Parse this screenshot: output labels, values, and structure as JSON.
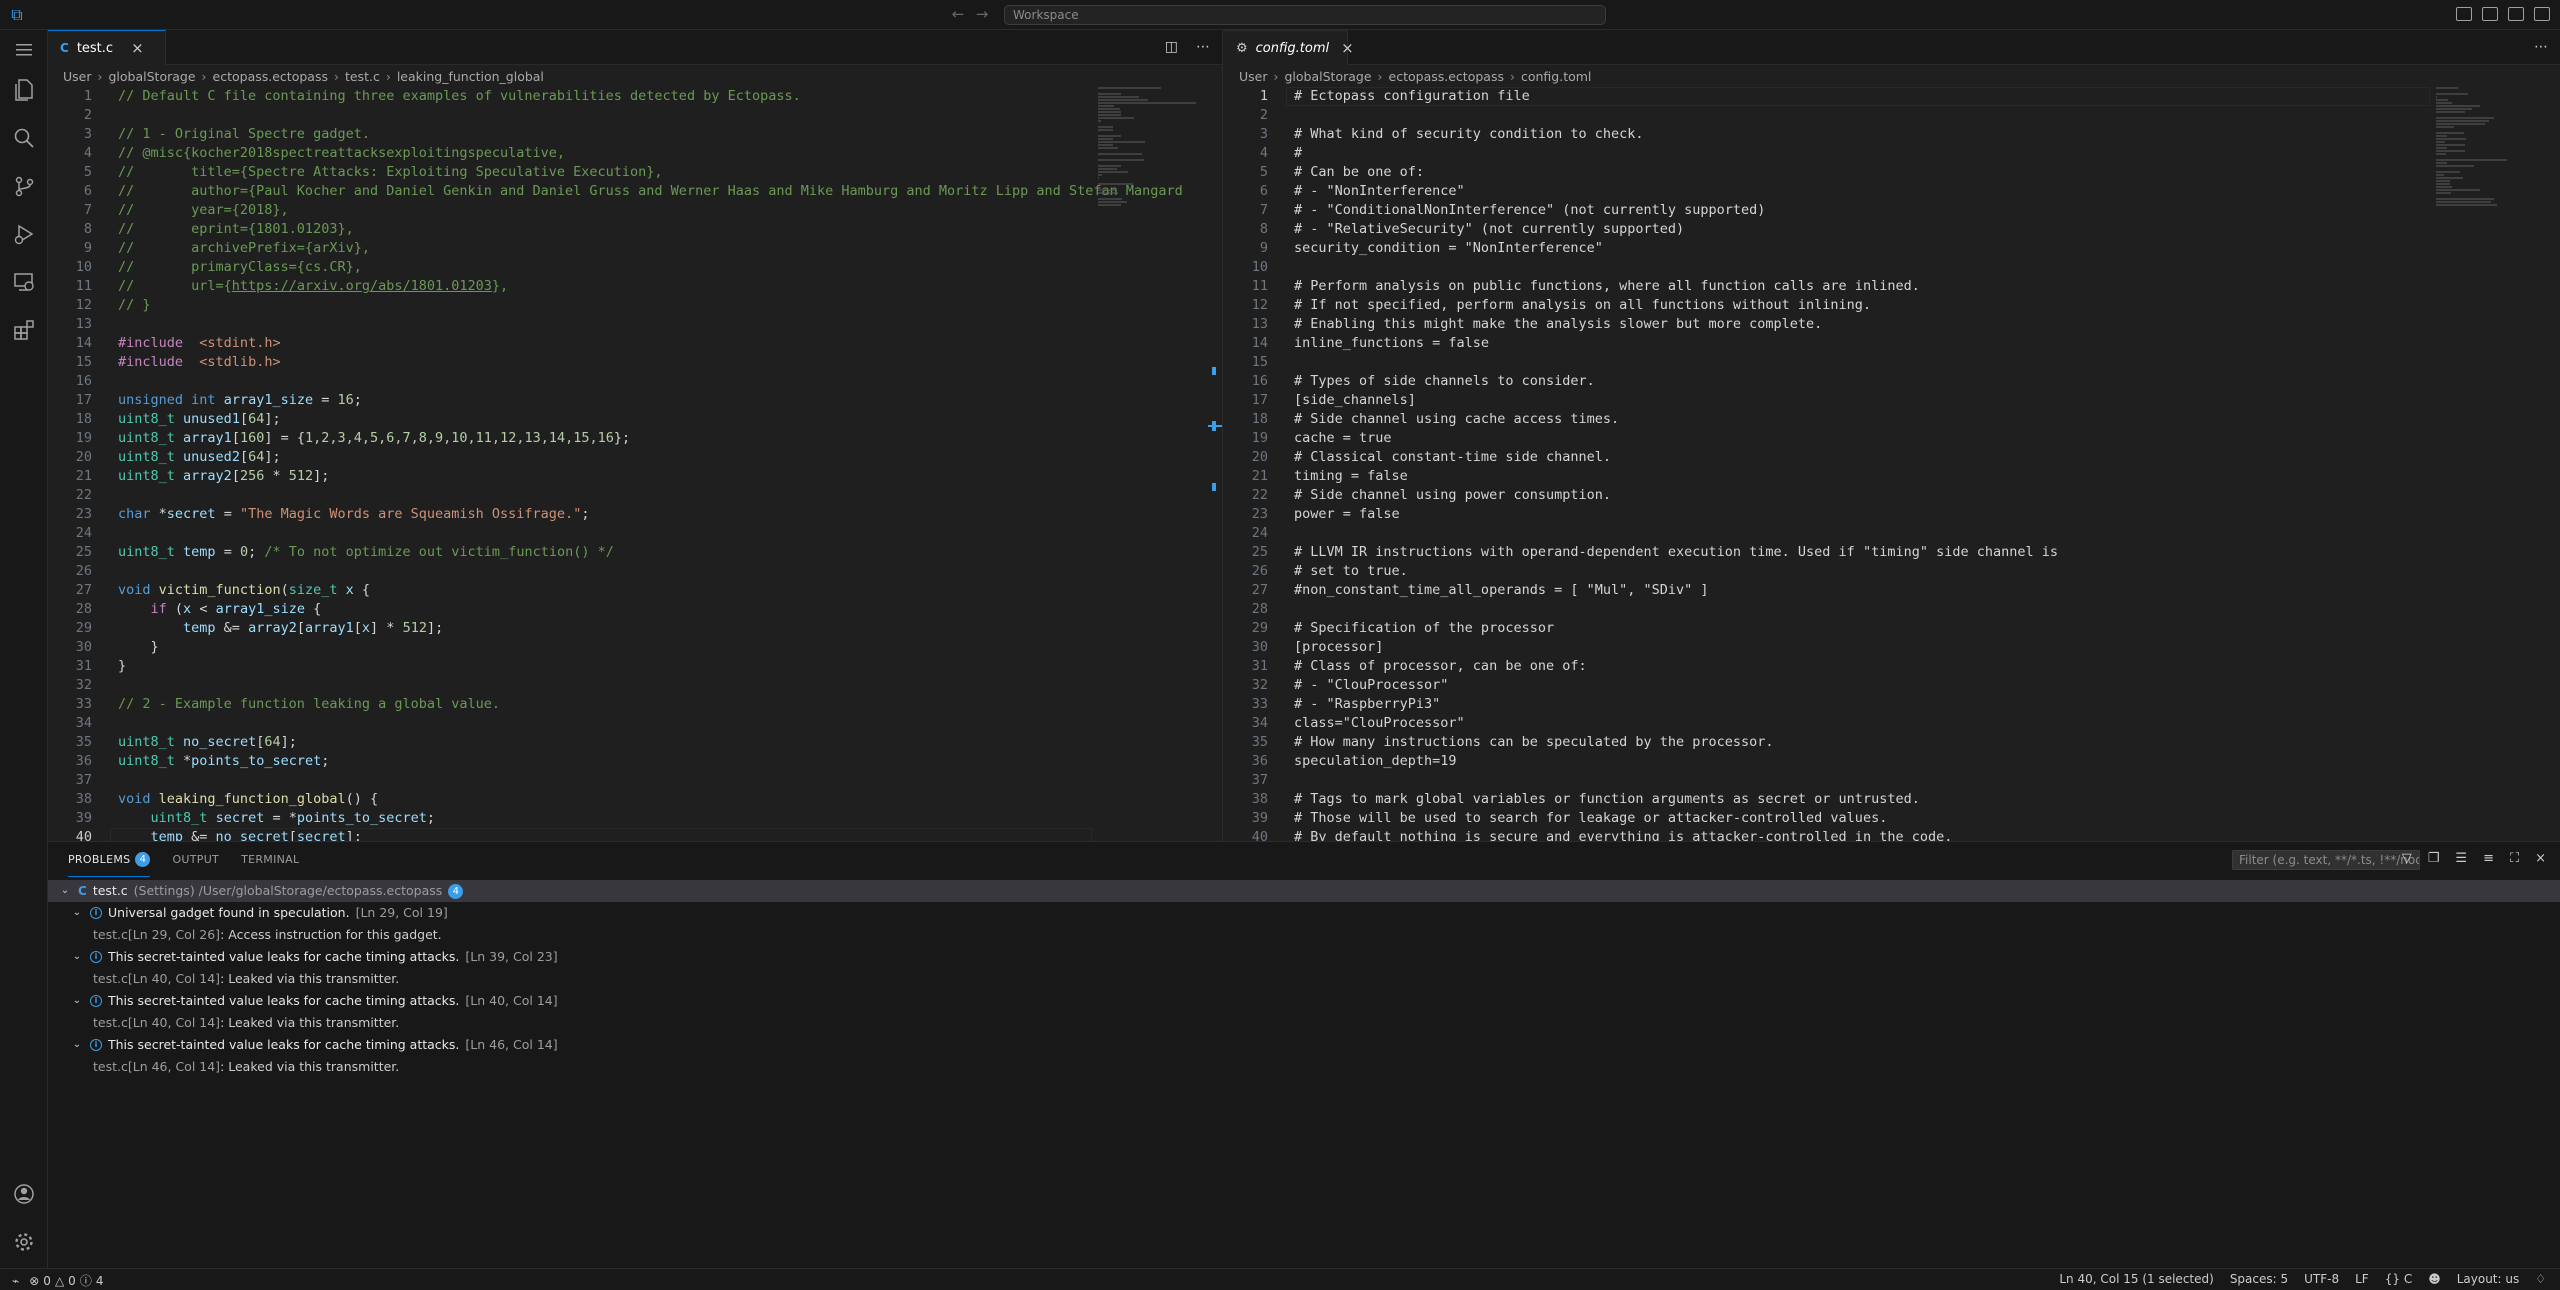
{
  "titlebar": {
    "search_placeholder": "Workspace",
    "colors": {
      "accent": "#0078d4",
      "info": "#3c9ee9"
    }
  },
  "left_editor": {
    "tab": {
      "icon": "C",
      "label": "test.c"
    },
    "breadcrumb": [
      "User",
      "globalStorage",
      "ectopass.ectopass",
      "test.c",
      "leaking_function_global"
    ],
    "active_line": 40,
    "lines": [
      [
        [
          "c-com",
          "// Default C file containing three examples of vulnerabilities detected by Ectopass."
        ]
      ],
      [],
      [
        [
          "c-com",
          "// 1 - Original Spectre gadget."
        ]
      ],
      [
        [
          "c-com",
          "// @misc{kocher2018spectreattacksexploitingspeculative,"
        ]
      ],
      [
        [
          "c-com",
          "//       title={Spectre Attacks: Exploiting Speculative Execution},"
        ]
      ],
      [
        [
          "c-com",
          "//       author={Paul Kocher and Daniel Genkin and Daniel Gruss and Werner Haas and Mike Hamburg and Moritz Lipp and Stefan Mangard"
        ]
      ],
      [
        [
          "c-com",
          "//       year={2018},"
        ]
      ],
      [
        [
          "c-com",
          "//       eprint={1801.01203},"
        ]
      ],
      [
        [
          "c-com",
          "//       archivePrefix={arXiv},"
        ]
      ],
      [
        [
          "c-com",
          "//       primaryClass={cs.CR},"
        ]
      ],
      [
        [
          "c-com",
          "//       url={"
        ],
        [
          "c-link",
          "https://arxiv.org/abs/1801.01203"
        ],
        [
          "c-com",
          "},"
        ]
      ],
      [
        [
          "c-com",
          "// }"
        ]
      ],
      [],
      [
        [
          "c-pp",
          "#include"
        ],
        [
          "",
          "  "
        ],
        [
          "c-inc",
          "<stdint.h>"
        ]
      ],
      [
        [
          "c-pp",
          "#include"
        ],
        [
          "",
          "  "
        ],
        [
          "c-inc",
          "<stdlib.h>"
        ]
      ],
      [],
      [
        [
          "c-kw",
          "unsigned int"
        ],
        [
          "",
          " "
        ],
        [
          "c-var",
          "array1_size"
        ],
        [
          "",
          " = "
        ],
        [
          "c-num",
          "16"
        ],
        [
          "",
          ";"
        ]
      ],
      [
        [
          "c-type",
          "uint8_t"
        ],
        [
          "",
          " "
        ],
        [
          "c-var",
          "unused1"
        ],
        [
          "",
          "["
        ],
        [
          "c-num",
          "64"
        ],
        [
          "",
          "];"
        ]
      ],
      [
        [
          "c-type",
          "uint8_t"
        ],
        [
          "",
          " "
        ],
        [
          "c-var",
          "array1"
        ],
        [
          "",
          "["
        ],
        [
          "c-num",
          "160"
        ],
        [
          "",
          "] = {"
        ],
        [
          "c-num",
          "1,2,3,4,5,6,7,8,9,10,11,12,13,14,15,16"
        ],
        [
          "",
          "};"
        ]
      ],
      [
        [
          "c-type",
          "uint8_t"
        ],
        [
          "",
          " "
        ],
        [
          "c-var",
          "unused2"
        ],
        [
          "",
          "["
        ],
        [
          "c-num",
          "64"
        ],
        [
          "",
          "];"
        ]
      ],
      [
        [
          "c-type",
          "uint8_t"
        ],
        [
          "",
          " "
        ],
        [
          "c-var",
          "array2"
        ],
        [
          "",
          "["
        ],
        [
          "c-num",
          "256"
        ],
        [
          "",
          " * "
        ],
        [
          "c-num",
          "512"
        ],
        [
          "",
          "];"
        ]
      ],
      [],
      [
        [
          "c-kw",
          "char"
        ],
        [
          "",
          " *"
        ],
        [
          "c-var",
          "secret"
        ],
        [
          "",
          " = "
        ],
        [
          "c-str",
          "\"The Magic Words are Squeamish Ossifrage.\""
        ],
        [
          "",
          ";"
        ]
      ],
      [],
      [
        [
          "c-type",
          "uint8_t"
        ],
        [
          "",
          " "
        ],
        [
          "c-var",
          "temp"
        ],
        [
          "",
          " = "
        ],
        [
          "c-num",
          "0"
        ],
        [
          "",
          "; "
        ],
        [
          "c-com",
          "/* To not optimize out victim_function() */"
        ]
      ],
      [],
      [
        [
          "c-kw",
          "void"
        ],
        [
          "",
          " "
        ],
        [
          "c-fn",
          "victim_function"
        ],
        [
          "",
          "("
        ],
        [
          "c-type",
          "size_t"
        ],
        [
          "",
          " "
        ],
        [
          "c-var",
          "x"
        ],
        [
          "",
          " {"
        ]
      ],
      [
        [
          "",
          "    "
        ],
        [
          "c-ctl",
          "if"
        ],
        [
          "",
          " ("
        ],
        [
          "c-var",
          "x"
        ],
        [
          "",
          " < "
        ],
        [
          "c-var",
          "array1_size"
        ],
        [
          "",
          " {"
        ]
      ],
      [
        [
          "",
          "        "
        ],
        [
          "c-var",
          "temp"
        ],
        [
          "",
          " &= "
        ],
        [
          "c-var",
          "array2"
        ],
        [
          "",
          "["
        ],
        [
          "c-var",
          "array1"
        ],
        [
          "",
          "["
        ],
        [
          "c-var",
          "x"
        ],
        [
          "",
          "] * "
        ],
        [
          "c-num",
          "512"
        ],
        [
          "",
          "];"
        ]
      ],
      [
        [
          "",
          "    }"
        ]
      ],
      [
        [
          "",
          "}"
        ]
      ],
      [],
      [
        [
          "c-com",
          "// 2 - Example function leaking a global value."
        ]
      ],
      [],
      [
        [
          "c-type",
          "uint8_t"
        ],
        [
          "",
          " "
        ],
        [
          "c-var",
          "no_secret"
        ],
        [
          "",
          "["
        ],
        [
          "c-num",
          "64"
        ],
        [
          "",
          "];"
        ]
      ],
      [
        [
          "c-type",
          "uint8_t"
        ],
        [
          "",
          " *"
        ],
        [
          "c-var",
          "points_to_secret"
        ],
        [
          "",
          ";"
        ]
      ],
      [],
      [
        [
          "c-kw",
          "void"
        ],
        [
          "",
          " "
        ],
        [
          "c-fn",
          "leaking_function_global"
        ],
        [
          "",
          "() {"
        ]
      ],
      [
        [
          "",
          "    "
        ],
        [
          "c-type",
          "uint8_t"
        ],
        [
          "",
          " "
        ],
        [
          "c-var",
          "secret"
        ],
        [
          "",
          " = *"
        ],
        [
          "c-var",
          "points_to_secret"
        ],
        [
          "",
          ";"
        ]
      ],
      [
        [
          "",
          "    "
        ],
        [
          "c-var",
          "temp"
        ],
        [
          "",
          " &= "
        ],
        [
          "c-var",
          "no_secret"
        ],
        [
          "",
          "["
        ],
        [
          "c-var",
          "secret"
        ],
        [
          "",
          "];"
        ]
      ]
    ]
  },
  "right_editor": {
    "tab": {
      "label": "config.toml"
    },
    "breadcrumb": [
      "User",
      "globalStorage",
      "ectopass.ectopass",
      "config.toml"
    ],
    "active_line": 1,
    "lines": [
      [
        [
          "",
          "# Ectopass configuration file"
        ]
      ],
      [],
      [
        [
          "",
          "# What kind of security condition to check."
        ]
      ],
      [
        [
          "",
          "#"
        ]
      ],
      [
        [
          "",
          "# Can be one of:"
        ]
      ],
      [
        [
          "",
          "# - \"NonInterference\""
        ]
      ],
      [
        [
          "",
          "# - \"ConditionalNonInterference\" (not currently supported)"
        ]
      ],
      [
        [
          "",
          "# - \"RelativeSecurity\" (not currently supported)"
        ]
      ],
      [
        [
          "",
          "security_condition = \"NonInterference\""
        ]
      ],
      [],
      [
        [
          "",
          "# Perform analysis on public functions, where all function calls are inlined."
        ]
      ],
      [
        [
          "",
          "# If not specified, perform analysis on all functions without inlining."
        ]
      ],
      [
        [
          "",
          "# Enabling this might make the analysis slower but more complete."
        ]
      ],
      [
        [
          "",
          "inline_functions = false"
        ]
      ],
      [],
      [
        [
          "",
          "# Types of side channels to consider."
        ]
      ],
      [
        [
          "",
          "[side_channels]"
        ]
      ],
      [
        [
          "",
          "# Side channel using cache access times."
        ]
      ],
      [
        [
          "",
          "cache = true"
        ]
      ],
      [
        [
          "",
          "# Classical constant-time side channel."
        ]
      ],
      [
        [
          "",
          "timing = false"
        ]
      ],
      [
        [
          "",
          "# Side channel using power consumption."
        ]
      ],
      [
        [
          "",
          "power = false"
        ]
      ],
      [],
      [
        [
          "",
          "# LLVM IR instructions with operand-dependent execution time. Used if \"timing\" side channel is"
        ]
      ],
      [
        [
          "",
          "# set to true."
        ]
      ],
      [
        [
          "",
          "#non_constant_time_all_operands = [ \"Mul\", \"SDiv\" ]"
        ]
      ],
      [],
      [
        [
          "",
          "# Specification of the processor"
        ]
      ],
      [
        [
          "",
          "[processor]"
        ]
      ],
      [
        [
          "",
          "# Class of processor, can be one of:"
        ]
      ],
      [
        [
          "",
          "# - \"ClouProcessor\""
        ]
      ],
      [
        [
          "",
          "# - \"RaspberryPi3\""
        ]
      ],
      [
        [
          "",
          "class=\"ClouProcessor\""
        ]
      ],
      [
        [
          "",
          "# How many instructions can be speculated by the processor."
        ]
      ],
      [
        [
          "",
          "speculation_depth=19"
        ]
      ],
      [],
      [
        [
          "",
          "# Tags to mark global variables or function arguments as secret or untrusted."
        ]
      ],
      [
        [
          "",
          "# Those will be used to search for leakage or attacker-controlled values."
        ]
      ],
      [
        [
          "",
          "# By default nothing is secure and everything is attacker-controlled in the code."
        ]
      ]
    ]
  },
  "panel": {
    "tabs": [
      {
        "label": "PROBLEMS",
        "badge": "4"
      },
      {
        "label": "OUTPUT"
      },
      {
        "label": "TERMINAL"
      }
    ],
    "filter_placeholder": "Filter (e.g. text, **/*.ts, !**/node_modules/**)",
    "file_row": {
      "name": "test.c",
      "detail": "(Settings) /User/globalStorage/ectopass.ectopass",
      "count": "4"
    },
    "problems": [
      {
        "message": "Universal gadget found in speculation.",
        "loc": "[Ln 29, Col 19]",
        "related_file": "test.c",
        "related_loc": "[Ln 29, Col 26]",
        "related_msg": ": Access instruction for this gadget."
      },
      {
        "message": "This secret-tainted value leaks for cache timing attacks.",
        "loc": "[Ln 39, Col 23]",
        "related_file": "test.c",
        "related_loc": "[Ln 40, Col 14]",
        "related_msg": ": Leaked via this transmitter."
      },
      {
        "message": "This secret-tainted value leaks for cache timing attacks.",
        "loc": "[Ln 40, Col 14]",
        "related_file": "test.c",
        "related_loc": "[Ln 40, Col 14]",
        "related_msg": ": Leaked via this transmitter."
      },
      {
        "message": "This secret-tainted value leaks for cache timing attacks.",
        "loc": "[Ln 46, Col 14]",
        "related_file": "test.c",
        "related_loc": "[Ln 46, Col 14]",
        "related_msg": ": Leaked via this transmitter."
      }
    ]
  },
  "statusbar": {
    "errors": "0",
    "warnings": "0",
    "infos": "4",
    "position": "Ln 40, Col 15 (1 selected)",
    "spaces": "Spaces: 5",
    "encoding": "UTF-8",
    "eol": "LF",
    "language": "C",
    "layout": "Layout: us"
  }
}
